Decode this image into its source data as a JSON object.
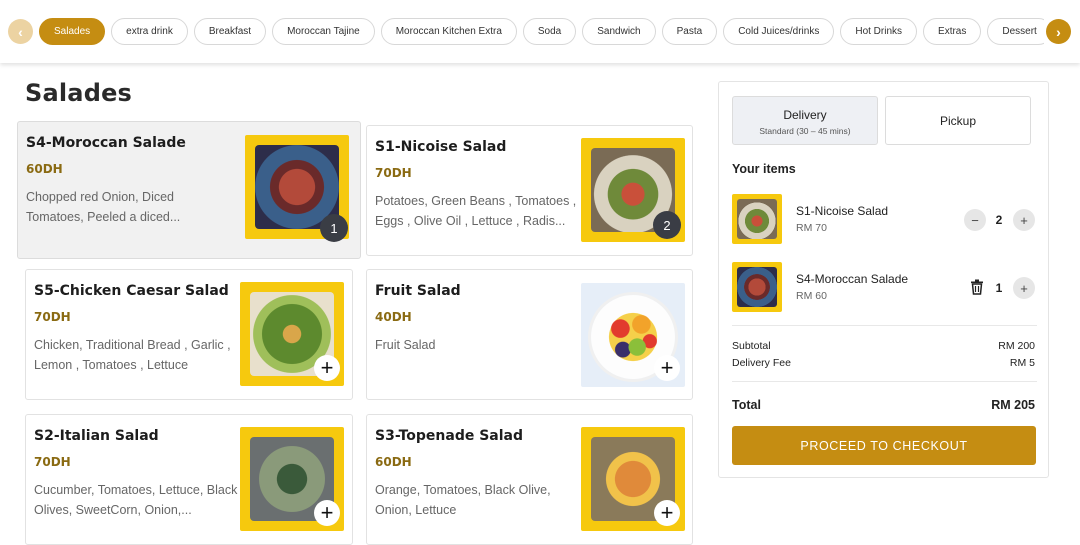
{
  "categories": {
    "items": [
      "Salades",
      "extra drink",
      "Breakfast",
      "Moroccan Tajine",
      "Moroccan Kitchen Extra",
      "Soda",
      "Sandwich",
      "Pasta",
      "Cold Juices/drinks",
      "Hot Drinks",
      "Extras",
      "Dessert"
    ],
    "active": "Salades",
    "prev_icon": "chevron-left-icon",
    "next_icon": "chevron-right-icon"
  },
  "section": {
    "title": "Salades"
  },
  "products": [
    {
      "name": "S4-Moroccan Salade",
      "price": "60DH",
      "desc": "Chopped red Onion, Diced Tomatoes, Peeled a diced...",
      "badge": "1"
    },
    {
      "name": "S1-Nicoise Salad",
      "price": "70DH",
      "desc": "Potatoes, Green Beans , Tomatoes , Eggs , Olive Oil , Lettuce , Radis...",
      "badge": "2"
    },
    {
      "name": "S5-Chicken Caesar Salad",
      "price": "70DH",
      "desc": "Chicken, Traditional Bread , Garlic , Lemon , Tomatoes , Lettuce",
      "badge": "+"
    },
    {
      "name": "Fruit Salad",
      "price": "40DH",
      "desc": "Fruit Salad",
      "badge": "+"
    },
    {
      "name": "S2-Italian Salad",
      "price": "70DH",
      "desc": "Cucumber, Tomatoes, Lettuce, Black Olives, SweetCorn, Onion,...",
      "badge": "+"
    },
    {
      "name": "S3-Topenade Salad",
      "price": "60DH",
      "desc": "Orange, Tomatoes, Black Olive, Onion, Lettuce",
      "badge": "+"
    }
  ],
  "cart": {
    "delivery_label": "Delivery",
    "delivery_sub": "Standard (30 – 45 mins)",
    "pickup_label": "Pickup",
    "your_items": "Your items",
    "items": [
      {
        "name": "S1-Nicoise Salad",
        "price": "RM 70",
        "qty": "2"
      },
      {
        "name": "S4-Moroccan Salade",
        "price": "RM 60",
        "qty": "1"
      }
    ],
    "subtotal_label": "Subtotal",
    "subtotal": "RM 200",
    "fee_label": "Delivery Fee",
    "fee": "RM 5",
    "total_label": "Total",
    "total": "RM 205",
    "checkout": "PROCEED TO CHECKOUT",
    "minus": "−",
    "plus": "+"
  },
  "colors": {
    "accent": "#c58d12",
    "price": "#8a6a12",
    "frame": "#f6c90e"
  }
}
